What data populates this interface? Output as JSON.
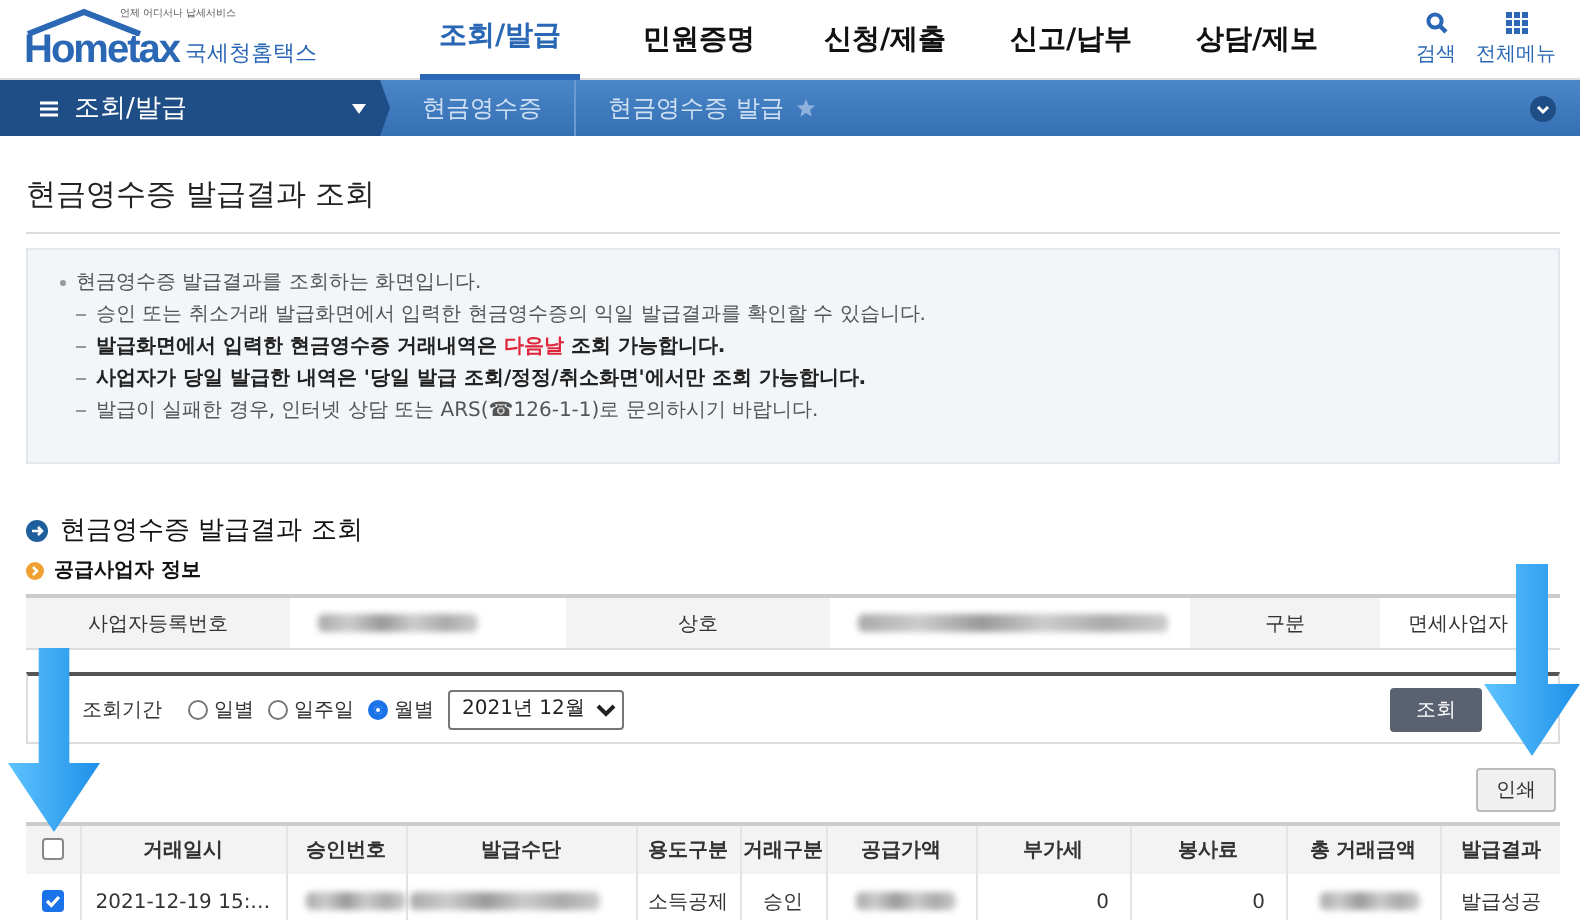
{
  "header": {
    "logo": {
      "small": "언제 어디서나 납세서비스",
      "brand": "Hometax",
      "tagline": "국세청홈택스"
    },
    "nav": [
      {
        "label": "조회/발급",
        "selected": true
      },
      {
        "label": "민원증명",
        "selected": false
      },
      {
        "label": "신청/제출",
        "selected": false
      },
      {
        "label": "신고/납부",
        "selected": false
      },
      {
        "label": "상담/제보",
        "selected": false
      }
    ],
    "tools": [
      {
        "kind": "search",
        "label": "검색"
      },
      {
        "kind": "menu",
        "label": "전체메뉴"
      }
    ]
  },
  "breadcrumb": {
    "menu": "조회/발급",
    "items": [
      "현금영수증",
      "현금영수증 발급"
    ],
    "favorite": false
  },
  "page_title": "현금영수증 발급결과 조회",
  "notice": [
    {
      "kind": "bullet",
      "text": "현금영수증 발급결과를 조회하는 화면입니다."
    },
    {
      "kind": "dash",
      "text": "승인 또는 취소거래 발급화면에서 입력한 현금영수증의 익일 발급결과를 확인할 수 있습니다."
    },
    {
      "kind": "dash-bold",
      "text": "발급화면에서 입력한 현금영수증 거래내역은 **다음날** 조회 가능합니다."
    },
    {
      "kind": "dash-bold",
      "text": "사업자가 당일 발급한 내역은 '당일 발급 조회/정정/취소화면'에서만 조회 가능합니다."
    },
    {
      "kind": "dash",
      "text": "발급이 실패한 경우, 인터넷 상담 또는 ARS(☎126-1-1)로 문의하시기 바랍니다."
    }
  ],
  "section_title": "현금영수증 발급결과 조회",
  "supplier": {
    "title": "공급사업자 정보",
    "fields": [
      {
        "label": "사업자등록번호",
        "value": {
          "kind": "blurred"
        }
      },
      {
        "label": "상호",
        "value": {
          "kind": "blurred"
        }
      },
      {
        "label": "구분",
        "value": {
          "kind": "text",
          "text": "면세사업자"
        }
      }
    ]
  },
  "search": {
    "label": "조회기간",
    "options": [
      {
        "label": "일별",
        "selected": false
      },
      {
        "label": "일주일",
        "selected": false
      },
      {
        "label": "월별",
        "selected": true
      }
    ],
    "month": "2021년 12월",
    "button": "조회"
  },
  "print_button": "인쇄",
  "table": {
    "all_checked": false,
    "columns": [
      {
        "label": "거래일시",
        "kind": "text"
      },
      {
        "label": "승인번호",
        "kind": "text"
      },
      {
        "label": "발급수단",
        "kind": "text"
      },
      {
        "label": "용도구분",
        "kind": "text"
      },
      {
        "label": "거래구분",
        "kind": "text"
      },
      {
        "label": "공급가액",
        "kind": "amount"
      },
      {
        "label": "부가세",
        "kind": "amount"
      },
      {
        "label": "봉사료",
        "kind": "amount"
      },
      {
        "label": "총 거래금액",
        "kind": "amount"
      },
      {
        "label": "발급결과",
        "kind": "text"
      }
    ],
    "rows": [
      {
        "checked": true,
        "cells": [
          {
            "kind": "text",
            "text": "2021-12-19 15:…"
          },
          {
            "kind": "blurred"
          },
          {
            "kind": "blurred"
          },
          {
            "kind": "text",
            "text": "소득공제"
          },
          {
            "kind": "text",
            "text": "승인"
          },
          {
            "kind": "blurred"
          },
          {
            "kind": "text",
            "text": "0"
          },
          {
            "kind": "text",
            "text": "0"
          },
          {
            "kind": "blurred"
          },
          {
            "kind": "text",
            "text": "발급성공"
          }
        ]
      }
    ]
  },
  "annotations": [
    {
      "kind": "arrow"
    },
    {
      "kind": "arrow"
    }
  ]
}
